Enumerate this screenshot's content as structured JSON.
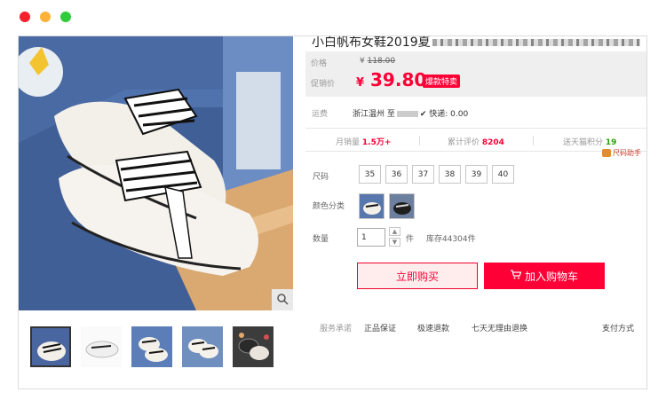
{
  "product": {
    "title": "小白帆布女鞋2019夏",
    "price_label": "价格",
    "original_price_symbol": "¥",
    "original_price": "118.00",
    "promo_label": "促销价",
    "promo_price_symbol": "¥",
    "promo_price": "39.80",
    "promo_badge": "爆款特卖",
    "shipping_label": "运费",
    "shipping_from": "浙江温州 至",
    "shipping_fee": "快递: 0.00"
  },
  "stats": {
    "monthly_sales_label": "月销量",
    "monthly_sales_value": "1.5万+",
    "reviews_label": "累计评价",
    "reviews_value": "8204",
    "points_label": "送天猫积分",
    "points_value": "19"
  },
  "size_helper": "尺码助手",
  "options": {
    "size_label": "尺码",
    "sizes": [
      "35",
      "36",
      "37",
      "38",
      "39",
      "40"
    ],
    "color_label": "颜色分类",
    "qty_label": "数量",
    "qty_value": "1",
    "qty_unit": "件",
    "stock": "库存44304件"
  },
  "actions": {
    "buy_now": "立即购买",
    "add_to_cart": "加入购物车"
  },
  "service": {
    "label": "服务承诺",
    "items": [
      "正品保证",
      "极速退款",
      "七天无理由退换"
    ],
    "payment": "支付方式"
  },
  "colors": {
    "accent": "#ff0036",
    "price_bg": "#efefef",
    "points_green": "#2aa10f"
  },
  "icons": {
    "zoom": "magnifier-icon",
    "cart": "cart-icon",
    "qty_up": "caret-up-icon",
    "qty_down": "caret-down-icon",
    "payment_caret": "chevron-down-icon"
  }
}
